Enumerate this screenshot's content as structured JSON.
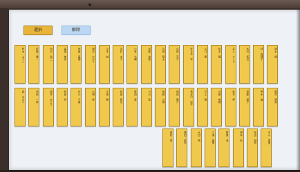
{
  "topbar": {
    "toggles": [
      {
        "label": "選択",
        "active": true
      },
      {
        "label": "解除",
        "active": false
      }
    ]
  },
  "rows": [
    {
      "tiles": [
        "鈴木 ようこ",
        "佐藤 健一",
        "田中 浩二",
        "高橋 美奈",
        "伊藤 直樹",
        "渡辺 かおり",
        "山本 誠",
        "中村 あや",
        "小林 大輔",
        "加藤 由美",
        "吉田 翔太",
        "山田 花子",
        "佐々木 学",
        "山口 恵",
        "松本 隆",
        "井上 さくら",
        "木村 拓也",
        "林 真理子",
        "清水 健"
      ]
    },
    {
      "tiles": [
        "森 ゆかり",
        "池田 一郎",
        "橋本 みどり",
        "阿部 亮",
        "石川 千春",
        "山崎 修",
        "中島 舞",
        "前田 和也",
        "藤田 葵",
        "小川 勇",
        "後藤 沙織",
        "岡田 陽介",
        "長谷川 紀子",
        "村上 剛",
        "近藤 美穂",
        "坂本 昇",
        "遠藤 優子",
        "青木 進",
        "藤井 明美"
      ]
    },
    {
      "tiles": [
        "西村 悟",
        "福田 結衣",
        "太田 晃",
        "三浦 直美",
        "藤原 浩",
        "岡本 彩",
        "松田 誠司",
        "中川 恵美"
      ]
    }
  ]
}
